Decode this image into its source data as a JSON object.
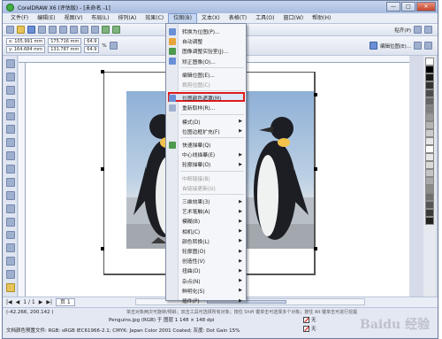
{
  "window": {
    "title": "CorelDRAW X6 (评估版) - [未命名 -1]",
    "controls": [
      "—",
      "□",
      "✕"
    ]
  },
  "menubar": {
    "items": [
      "文件(F)",
      "编辑(E)",
      "视图(V)",
      "布局(L)",
      "排列(A)",
      "效果(C)",
      "位图(B)",
      "文本(X)",
      "表格(T)",
      "工具(O)",
      "窗口(W)",
      "帮助(H)"
    ],
    "active_index": 6
  },
  "toolbar_top": {
    "snap_label": "贴齐(P)"
  },
  "property_bar": {
    "x": "x: 105.991 mm",
    "y": "y: 164.684 mm",
    "width": "175.716 mm",
    "height": "131.787 mm",
    "scale_x": "64.9",
    "scale_y": "64.9",
    "pct": "%",
    "edit_bitmap": "编辑位图(E)..."
  },
  "bitmap_menu": {
    "items": [
      {
        "label": "转换为位图(P)...",
        "icon": "convert-bitmap-icon",
        "arrow": false,
        "disabled": false
      },
      {
        "label": "自动调整",
        "icon": "auto-adjust-icon",
        "arrow": false,
        "disabled": false
      },
      {
        "label": "图像调整实验室(J)...",
        "icon": "image-lab-icon",
        "arrow": false,
        "disabled": false
      },
      {
        "label": "矫正图像(O)...",
        "icon": "straighten-icon",
        "arrow": false,
        "disabled": false
      },
      {
        "label": "编辑位图(E)...",
        "icon": "",
        "arrow": false,
        "disabled": false
      },
      {
        "label": "裁剪位图(C)",
        "icon": "",
        "arrow": false,
        "disabled": true
      },
      {
        "label": "位图颜色遮罩(M)",
        "icon": "color-mask-icon",
        "arrow": false,
        "disabled": false
      },
      {
        "label": "重新取样(R)...",
        "icon": "resample-icon",
        "arrow": false,
        "disabled": false
      },
      {
        "label": "模式(D)",
        "icon": "",
        "arrow": true,
        "disabled": false
      },
      {
        "label": "位图边框扩充(F)",
        "icon": "",
        "arrow": true,
        "disabled": false
      },
      {
        "label": "快速描摹(Q)",
        "icon": "quick-trace-icon",
        "arrow": false,
        "disabled": false
      },
      {
        "label": "中心线描摹(E)",
        "icon": "",
        "arrow": true,
        "disabled": false
      },
      {
        "label": "轮廓描摹(O)",
        "icon": "",
        "arrow": true,
        "disabled": false
      },
      {
        "label": "中断链接(B)",
        "icon": "",
        "arrow": false,
        "disabled": true
      },
      {
        "label": "自链接更新(U)",
        "icon": "",
        "arrow": false,
        "disabled": true
      },
      {
        "label": "三维效果(3)",
        "icon": "",
        "arrow": true,
        "disabled": false
      },
      {
        "label": "艺术笔触(A)",
        "icon": "",
        "arrow": true,
        "disabled": false
      },
      {
        "label": "模糊(B)",
        "icon": "",
        "arrow": true,
        "disabled": false
      },
      {
        "label": "相机(C)",
        "icon": "",
        "arrow": true,
        "disabled": false
      },
      {
        "label": "颜色转换(L)",
        "icon": "",
        "arrow": true,
        "disabled": false
      },
      {
        "label": "轮廓图(O)",
        "icon": "",
        "arrow": true,
        "disabled": false
      },
      {
        "label": "创造性(V)",
        "icon": "",
        "arrow": true,
        "disabled": false
      },
      {
        "label": "扭曲(D)",
        "icon": "",
        "arrow": true,
        "disabled": false
      },
      {
        "label": "杂点(N)",
        "icon": "",
        "arrow": true,
        "disabled": false
      },
      {
        "label": "鲜明化(S)",
        "icon": "",
        "arrow": true,
        "disabled": false
      },
      {
        "label": "插件(P)",
        "icon": "",
        "arrow": true,
        "disabled": false
      }
    ],
    "highlighted_index": 6
  },
  "page_nav": {
    "counter": "1 / 1",
    "page_tab": "页 1"
  },
  "status": {
    "coords": "(-42.266, 200.142 )",
    "hint": "Penguins.jpg (RGB) 于 图层 1 148 × 148 dpi",
    "hint_top": "单击对象两次可旋转/倾斜；双击工具可选择所有对象；按住 Shift 键单击可选择多个对象；按住 Alt 键单击可进行挖掘",
    "doc_profile": "文档颜色预置文件: RGB: sRGB IEC61966-2.1; CMYK: Japan Color 2001 Coated; 灰度: Dot Gain 15%",
    "fill_none": "无",
    "outline_none": "无"
  },
  "colors": {
    "accent": "#e01a1a",
    "menu_bg": "#f5f6f9",
    "titlebar": "#a8bcdf"
  },
  "watermark": "Baidu 经验"
}
